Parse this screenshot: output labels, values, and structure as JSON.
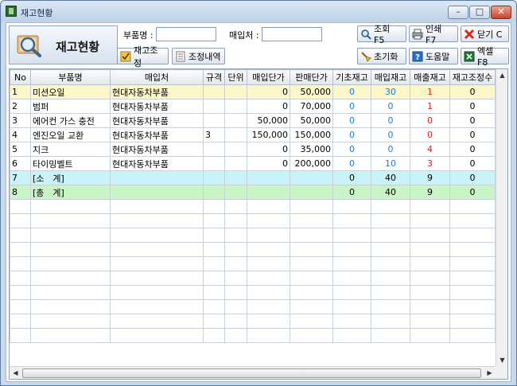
{
  "window": {
    "title": "재고현황"
  },
  "header": {
    "title": "재고현황"
  },
  "filters": {
    "part_label": "부품명 :",
    "part_value": "",
    "vendor_label": "매입처 :",
    "vendor_value": ""
  },
  "toolbar": {
    "adjust": "재고조정",
    "adjust_history": "조정내역",
    "search": "조회 F5",
    "print": "인쇄 F7",
    "close": "닫기 C",
    "reset": "초기화",
    "help": "도움말",
    "excel": "엑셀 F8"
  },
  "colors": {
    "selected_row": "#fbf7c8",
    "subtotal_row": "#c8f3f8",
    "total_row": "#c8f4c6",
    "blue_value": "#1f7ae0",
    "red_value": "#e02020"
  },
  "table": {
    "headers": [
      "No",
      "부품명",
      "매입처",
      "규격",
      "단위",
      "매입단가",
      "판매단가",
      "기초재고",
      "매입재고",
      "매출재고",
      "재고조정수"
    ],
    "rows": [
      {
        "no": "1",
        "name": "미션오일",
        "vendor": "현대자동차부품",
        "spec": "",
        "unit": "",
        "buy": "0",
        "sell": "50,000",
        "base": "0",
        "in": "30",
        "out": "1",
        "adj": "0"
      },
      {
        "no": "2",
        "name": "범퍼",
        "vendor": "현대자동차부품",
        "spec": "",
        "unit": "",
        "buy": "0",
        "sell": "70,000",
        "base": "0",
        "in": "0",
        "out": "1",
        "adj": "0"
      },
      {
        "no": "3",
        "name": "에어컨 가스 충전",
        "vendor": "현대자동차부품",
        "spec": "",
        "unit": "",
        "buy": "50,000",
        "sell": "50,000",
        "base": "0",
        "in": "0",
        "out": "0",
        "adj": "0"
      },
      {
        "no": "4",
        "name": "엔진오일 교환",
        "vendor": "현대자동차부품",
        "spec": "3",
        "unit": "",
        "buy": "150,000",
        "sell": "150,000",
        "base": "0",
        "in": "0",
        "out": "0",
        "adj": "0"
      },
      {
        "no": "5",
        "name": "지크",
        "vendor": "현대자동차부품",
        "spec": "",
        "unit": "",
        "buy": "0",
        "sell": "35,000",
        "base": "0",
        "in": "0",
        "out": "4",
        "adj": "0"
      },
      {
        "no": "6",
        "name": "타이밍벨트",
        "vendor": "현대자동차부품",
        "spec": "",
        "unit": "",
        "buy": "0",
        "sell": "200,000",
        "base": "0",
        "in": "10",
        "out": "3",
        "adj": "0"
      },
      {
        "no": "7",
        "name": "[소　계]",
        "vendor": "",
        "spec": "",
        "unit": "",
        "buy": "",
        "sell": "",
        "base": "0",
        "in": "40",
        "out": "9",
        "adj": "0"
      },
      {
        "no": "8",
        "name": "[총　계]",
        "vendor": "",
        "spec": "",
        "unit": "",
        "buy": "",
        "sell": "",
        "base": "0",
        "in": "40",
        "out": "9",
        "adj": "0"
      }
    ]
  }
}
